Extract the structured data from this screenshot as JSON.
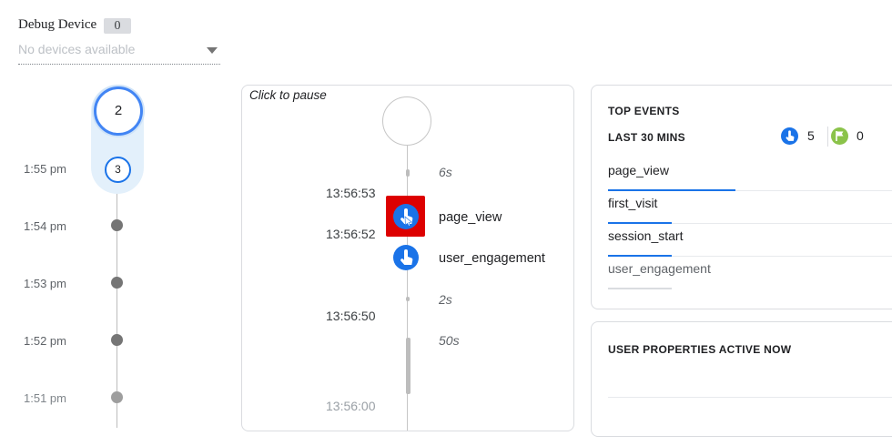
{
  "debug_device": {
    "label": "Debug Device",
    "count": "0",
    "placeholder": "No devices available"
  },
  "minutes_stream": {
    "current_count": "2",
    "recent_count": "3",
    "times": [
      "1:55 pm",
      "1:54 pm",
      "1:53 pm",
      "1:52 pm",
      "1:51 pm"
    ]
  },
  "seconds_stream": {
    "pause_hint": "Click to pause",
    "gaps": [
      "6s",
      "2s",
      "50s"
    ],
    "timestamps": [
      "13:56:53",
      "13:56:52",
      "13:56:50",
      "13:56:00"
    ],
    "events": [
      {
        "name": "page_view",
        "icon": "touch-icon"
      },
      {
        "name": "user_engagement",
        "icon": "touch-icon"
      }
    ]
  },
  "top_events": {
    "title": "TOP EVENTS",
    "subtitle": "LAST 30 MINS",
    "event_count": "5",
    "conversion_count": "0",
    "event_count_icon": "touch-icon",
    "conversion_count_icon": "flag-icon",
    "accent": "#1a73e8",
    "conversion_color": "#8bc34a",
    "items": [
      {
        "name": "page_view",
        "share": 1.0
      },
      {
        "name": "first_visit",
        "share": 0.5
      },
      {
        "name": "session_start",
        "share": 0.5
      },
      {
        "name": "user_engagement",
        "share": 0.5
      }
    ]
  },
  "user_properties": {
    "title": "USER PROPERTIES ACTIVE NOW"
  },
  "colors": {
    "highlight": "#dd0000",
    "event_blue": "#1a73e8",
    "minute_ring": "#4285f4"
  }
}
